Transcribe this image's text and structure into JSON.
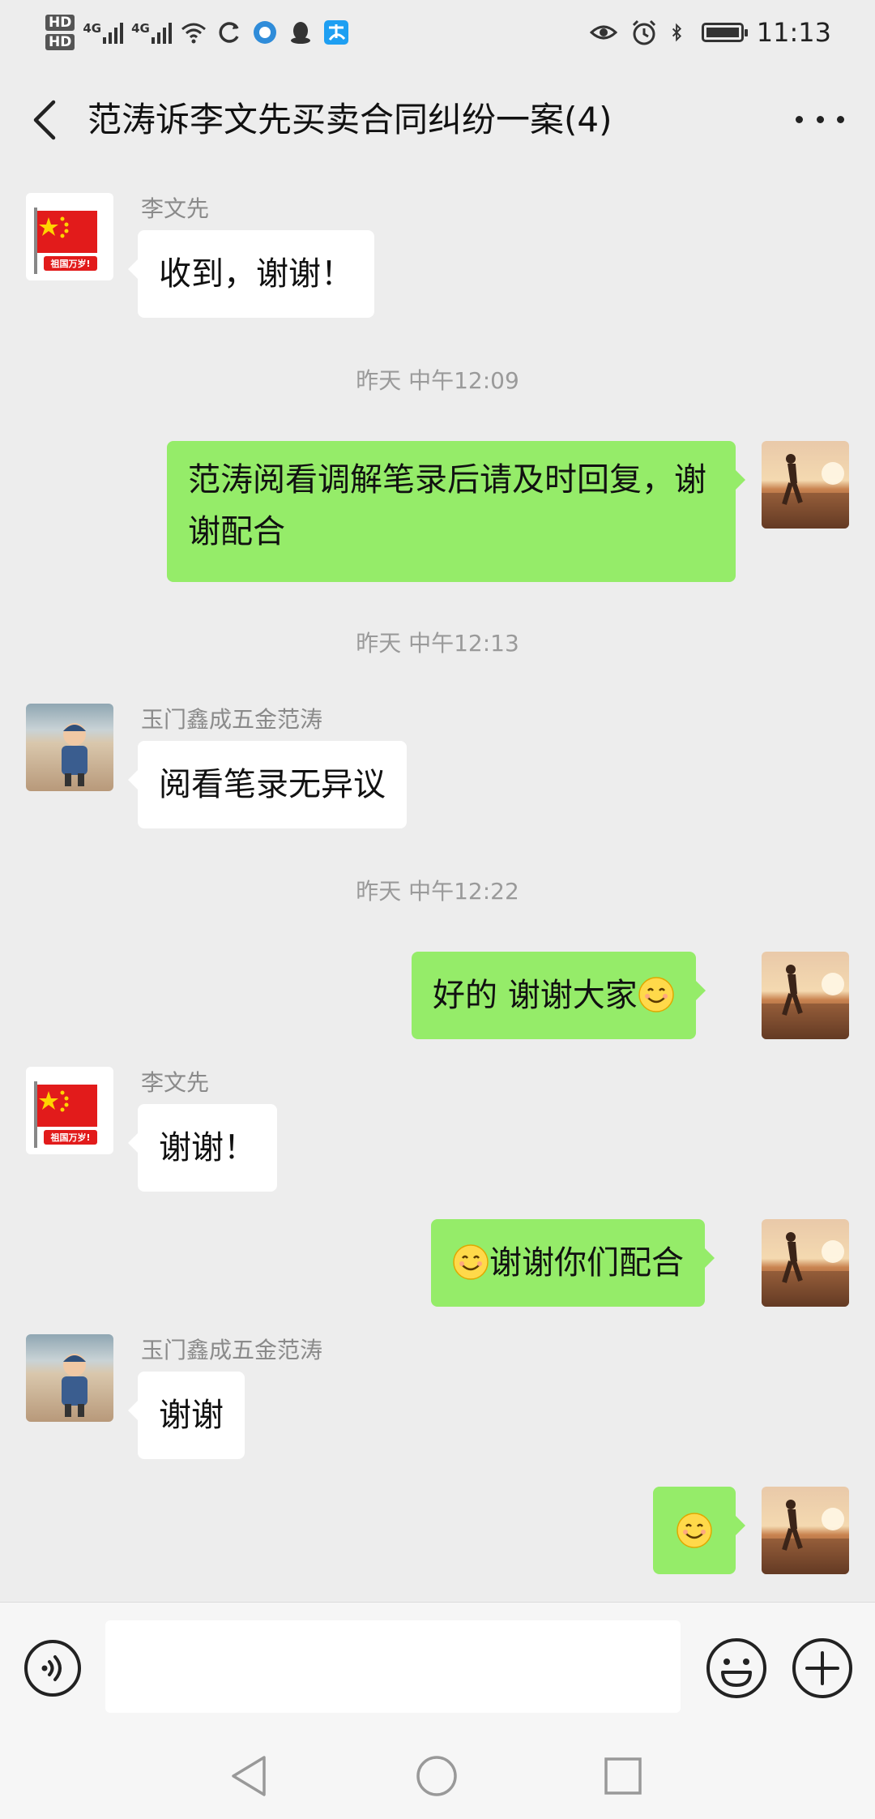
{
  "status_bar": {
    "hd1": "HD",
    "hd2": "HD",
    "net1": "4G",
    "net2": "4G",
    "time": "11:13"
  },
  "header": {
    "title": "范涛诉李文先买卖合同纠纷一案(4)"
  },
  "messages": [
    {
      "sender": "李文先",
      "text": "收到，谢谢！"
    },
    {
      "timestamp": "昨天 中午12:09"
    },
    {
      "text": "范涛阅看调解笔录后请及时回复，谢谢配合"
    },
    {
      "timestamp": "昨天 中午12:13"
    },
    {
      "sender": "玉门鑫成五金范涛",
      "text": "阅看笔录无异议"
    },
    {
      "timestamp": "昨天 中午12:22"
    },
    {
      "text": "好的  谢谢大家"
    },
    {
      "sender": "李文先",
      "text": "谢谢！"
    },
    {
      "text": "谢谢你们配合"
    },
    {
      "sender": "玉门鑫成五金范涛",
      "text": "谢谢"
    }
  ],
  "avatar_flag_text": "祖国万岁!",
  "colors": {
    "background": "#ededed",
    "bubble_out": "#95ec69",
    "bubble_in": "#ffffff"
  },
  "icons": [
    "back-icon",
    "more-icon",
    "voice-icon",
    "emoji-icon",
    "plus-icon",
    "smile-emoji-icon",
    "nav-back-icon",
    "nav-home-icon",
    "nav-recent-icon"
  ]
}
